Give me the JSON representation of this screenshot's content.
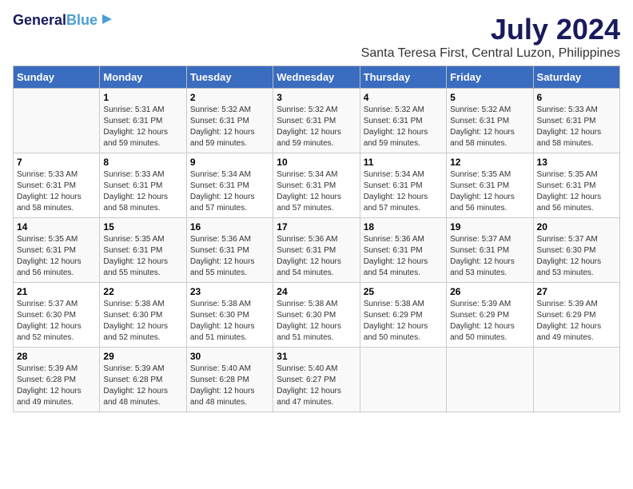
{
  "logo": {
    "line1": "General",
    "line2": "Blue"
  },
  "title": "July 2024",
  "subtitle": "Santa Teresa First, Central Luzon, Philippines",
  "days_header": [
    "Sunday",
    "Monday",
    "Tuesday",
    "Wednesday",
    "Thursday",
    "Friday",
    "Saturday"
  ],
  "weeks": [
    [
      {
        "day": "",
        "info": ""
      },
      {
        "day": "1",
        "info": "Sunrise: 5:31 AM\nSunset: 6:31 PM\nDaylight: 12 hours\nand 59 minutes."
      },
      {
        "day": "2",
        "info": "Sunrise: 5:32 AM\nSunset: 6:31 PM\nDaylight: 12 hours\nand 59 minutes."
      },
      {
        "day": "3",
        "info": "Sunrise: 5:32 AM\nSunset: 6:31 PM\nDaylight: 12 hours\nand 59 minutes."
      },
      {
        "day": "4",
        "info": "Sunrise: 5:32 AM\nSunset: 6:31 PM\nDaylight: 12 hours\nand 59 minutes."
      },
      {
        "day": "5",
        "info": "Sunrise: 5:32 AM\nSunset: 6:31 PM\nDaylight: 12 hours\nand 58 minutes."
      },
      {
        "day": "6",
        "info": "Sunrise: 5:33 AM\nSunset: 6:31 PM\nDaylight: 12 hours\nand 58 minutes."
      }
    ],
    [
      {
        "day": "7",
        "info": "Sunrise: 5:33 AM\nSunset: 6:31 PM\nDaylight: 12 hours\nand 58 minutes."
      },
      {
        "day": "8",
        "info": "Sunrise: 5:33 AM\nSunset: 6:31 PM\nDaylight: 12 hours\nand 58 minutes."
      },
      {
        "day": "9",
        "info": "Sunrise: 5:34 AM\nSunset: 6:31 PM\nDaylight: 12 hours\nand 57 minutes."
      },
      {
        "day": "10",
        "info": "Sunrise: 5:34 AM\nSunset: 6:31 PM\nDaylight: 12 hours\nand 57 minutes."
      },
      {
        "day": "11",
        "info": "Sunrise: 5:34 AM\nSunset: 6:31 PM\nDaylight: 12 hours\nand 57 minutes."
      },
      {
        "day": "12",
        "info": "Sunrise: 5:35 AM\nSunset: 6:31 PM\nDaylight: 12 hours\nand 56 minutes."
      },
      {
        "day": "13",
        "info": "Sunrise: 5:35 AM\nSunset: 6:31 PM\nDaylight: 12 hours\nand 56 minutes."
      }
    ],
    [
      {
        "day": "14",
        "info": "Sunrise: 5:35 AM\nSunset: 6:31 PM\nDaylight: 12 hours\nand 56 minutes."
      },
      {
        "day": "15",
        "info": "Sunrise: 5:35 AM\nSunset: 6:31 PM\nDaylight: 12 hours\nand 55 minutes."
      },
      {
        "day": "16",
        "info": "Sunrise: 5:36 AM\nSunset: 6:31 PM\nDaylight: 12 hours\nand 55 minutes."
      },
      {
        "day": "17",
        "info": "Sunrise: 5:36 AM\nSunset: 6:31 PM\nDaylight: 12 hours\nand 54 minutes."
      },
      {
        "day": "18",
        "info": "Sunrise: 5:36 AM\nSunset: 6:31 PM\nDaylight: 12 hours\nand 54 minutes."
      },
      {
        "day": "19",
        "info": "Sunrise: 5:37 AM\nSunset: 6:31 PM\nDaylight: 12 hours\nand 53 minutes."
      },
      {
        "day": "20",
        "info": "Sunrise: 5:37 AM\nSunset: 6:30 PM\nDaylight: 12 hours\nand 53 minutes."
      }
    ],
    [
      {
        "day": "21",
        "info": "Sunrise: 5:37 AM\nSunset: 6:30 PM\nDaylight: 12 hours\nand 52 minutes."
      },
      {
        "day": "22",
        "info": "Sunrise: 5:38 AM\nSunset: 6:30 PM\nDaylight: 12 hours\nand 52 minutes."
      },
      {
        "day": "23",
        "info": "Sunrise: 5:38 AM\nSunset: 6:30 PM\nDaylight: 12 hours\nand 51 minutes."
      },
      {
        "day": "24",
        "info": "Sunrise: 5:38 AM\nSunset: 6:30 PM\nDaylight: 12 hours\nand 51 minutes."
      },
      {
        "day": "25",
        "info": "Sunrise: 5:38 AM\nSunset: 6:29 PM\nDaylight: 12 hours\nand 50 minutes."
      },
      {
        "day": "26",
        "info": "Sunrise: 5:39 AM\nSunset: 6:29 PM\nDaylight: 12 hours\nand 50 minutes."
      },
      {
        "day": "27",
        "info": "Sunrise: 5:39 AM\nSunset: 6:29 PM\nDaylight: 12 hours\nand 49 minutes."
      }
    ],
    [
      {
        "day": "28",
        "info": "Sunrise: 5:39 AM\nSunset: 6:28 PM\nDaylight: 12 hours\nand 49 minutes."
      },
      {
        "day": "29",
        "info": "Sunrise: 5:39 AM\nSunset: 6:28 PM\nDaylight: 12 hours\nand 48 minutes."
      },
      {
        "day": "30",
        "info": "Sunrise: 5:40 AM\nSunset: 6:28 PM\nDaylight: 12 hours\nand 48 minutes."
      },
      {
        "day": "31",
        "info": "Sunrise: 5:40 AM\nSunset: 6:27 PM\nDaylight: 12 hours\nand 47 minutes."
      },
      {
        "day": "",
        "info": ""
      },
      {
        "day": "",
        "info": ""
      },
      {
        "day": "",
        "info": ""
      }
    ]
  ]
}
